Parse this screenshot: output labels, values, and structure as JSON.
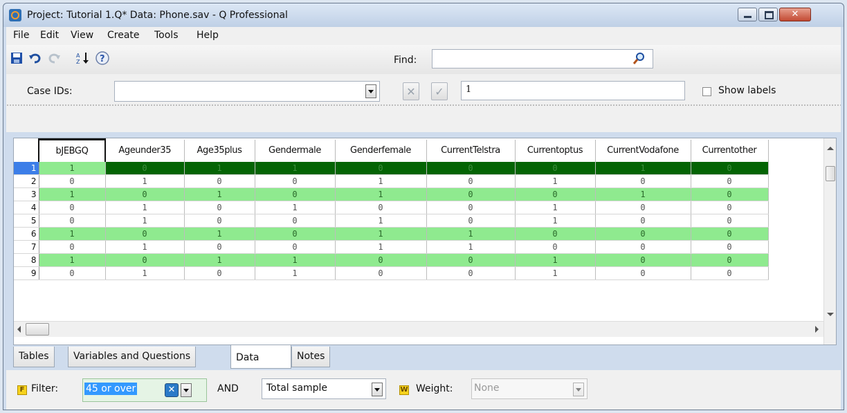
{
  "window": {
    "title": "Project: Tutorial 1.Q*  Data: Phone.sav - Q Professional"
  },
  "menu": [
    "File",
    "Edit",
    "View",
    "Create",
    "Tools",
    "Help"
  ],
  "toolbar": {
    "icons": [
      "save-icon",
      "undo-icon",
      "redo-icon",
      "sort-az-icon",
      "help-icon",
      "search-icon"
    ],
    "find_label": "Find:",
    "find_value": ""
  },
  "case_bar": {
    "label": "Case IDs:",
    "combo_value": "",
    "edit_value": "1",
    "show_labels": "Show labels",
    "show_labels_checked": false
  },
  "grid": {
    "columns": [
      "bJEBGQ",
      "Ageunder35",
      "Age35plus",
      "Gendermale",
      "Genderfemale",
      "CurrentTelstra",
      "Currentoptus",
      "CurrentVodafone",
      "Currentother"
    ],
    "rows": [
      {
        "id": "1",
        "values": [
          "1",
          "0",
          "1",
          "1",
          "0",
          "0",
          "0",
          "1",
          "0"
        ]
      },
      {
        "id": "2",
        "values": [
          "0",
          "1",
          "0",
          "0",
          "1",
          "0",
          "1",
          "0",
          "0"
        ]
      },
      {
        "id": "3",
        "values": [
          "1",
          "0",
          "1",
          "0",
          "1",
          "0",
          "0",
          "1",
          "0"
        ]
      },
      {
        "id": "4",
        "values": [
          "0",
          "1",
          "0",
          "1",
          "0",
          "0",
          "1",
          "0",
          "0"
        ]
      },
      {
        "id": "5",
        "values": [
          "0",
          "1",
          "0",
          "0",
          "1",
          "0",
          "1",
          "0",
          "0"
        ]
      },
      {
        "id": "6",
        "values": [
          "1",
          "0",
          "1",
          "0",
          "1",
          "1",
          "0",
          "0",
          "0"
        ]
      },
      {
        "id": "7",
        "values": [
          "0",
          "1",
          "0",
          "0",
          "1",
          "1",
          "0",
          "0",
          "0"
        ]
      },
      {
        "id": "8",
        "values": [
          "1",
          "0",
          "1",
          "1",
          "0",
          "0",
          "1",
          "0",
          "0"
        ]
      },
      {
        "id": "9",
        "values": [
          "0",
          "1",
          "0",
          "1",
          "0",
          "0",
          "1",
          "0",
          "0"
        ]
      }
    ],
    "selected_row": "1",
    "highlighted_rows": [
      "1",
      "3",
      "6",
      "8"
    ],
    "colors": {
      "highlight": "#8fea8f",
      "selected": "#046404",
      "selected_header": "#3c7ee8"
    }
  },
  "tabs": [
    "Tables",
    "Variables and Questions",
    "Data",
    "Notes"
  ],
  "active_tab": "Data",
  "filter_bar": {
    "filter_label": "Filter:",
    "filter_value": "45 or over",
    "and_label": "AND",
    "sample_value": "Total sample",
    "weight_label": "Weight:",
    "weight_value": "None",
    "filter_icon_letter": "F",
    "weight_icon_letter": "W"
  }
}
